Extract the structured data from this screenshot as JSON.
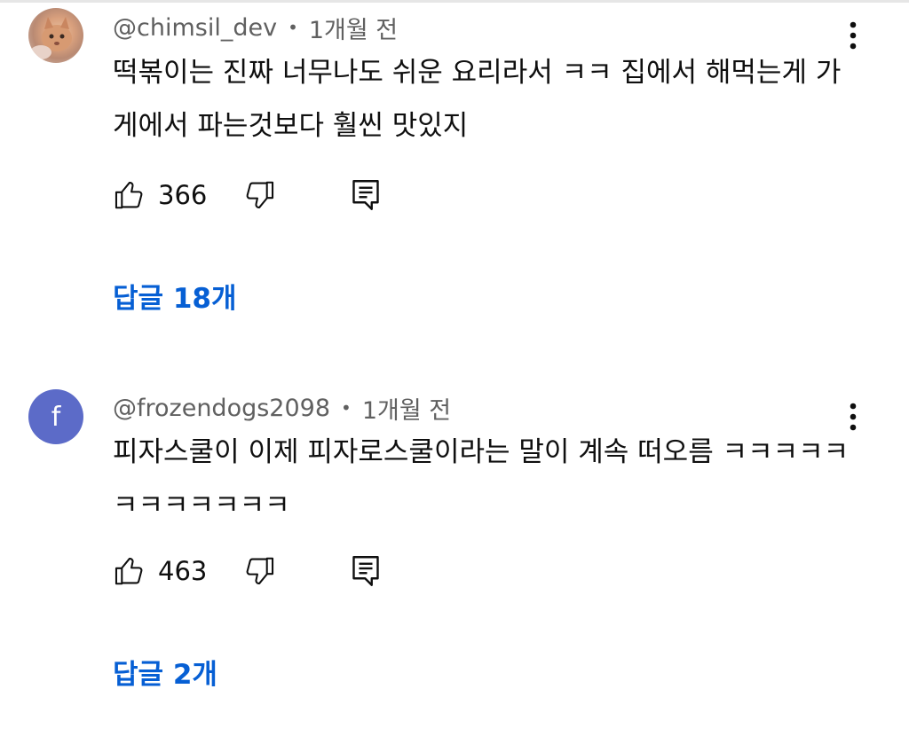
{
  "comments": [
    {
      "author": "@chimsil_dev",
      "separator": "•",
      "time": "1개월 전",
      "avatar": {
        "type": "photo",
        "description_icon": "cat-photo-avatar"
      },
      "text": "떡볶이는 진짜 너무나도 쉬운 요리라서 ㅋㅋ 집에서 해먹는게 가게에서 파는것보다 훨씬 맛있지",
      "likes": "366",
      "replies_label": "답글 18개"
    },
    {
      "author": "@frozendogs2098",
      "separator": "•",
      "time": "1개월 전",
      "avatar": {
        "type": "letter",
        "letter": "f",
        "color": "#5c6bc8"
      },
      "text": "피자스쿨이 이제 피자로스쿨이라는 말이 계속 떠오름 ㅋㅋㅋㅋㅋㅋㅋㅋㅋㅋㅋㅋ",
      "likes": "463",
      "replies_label": "답글 2개"
    }
  ],
  "colors": {
    "link": "#065fd4",
    "meta": "#606060",
    "text": "#0f0f0f"
  },
  "icons": [
    "thumbs-up-icon",
    "thumbs-down-icon",
    "reply-comment-icon",
    "more-vert-icon"
  ]
}
